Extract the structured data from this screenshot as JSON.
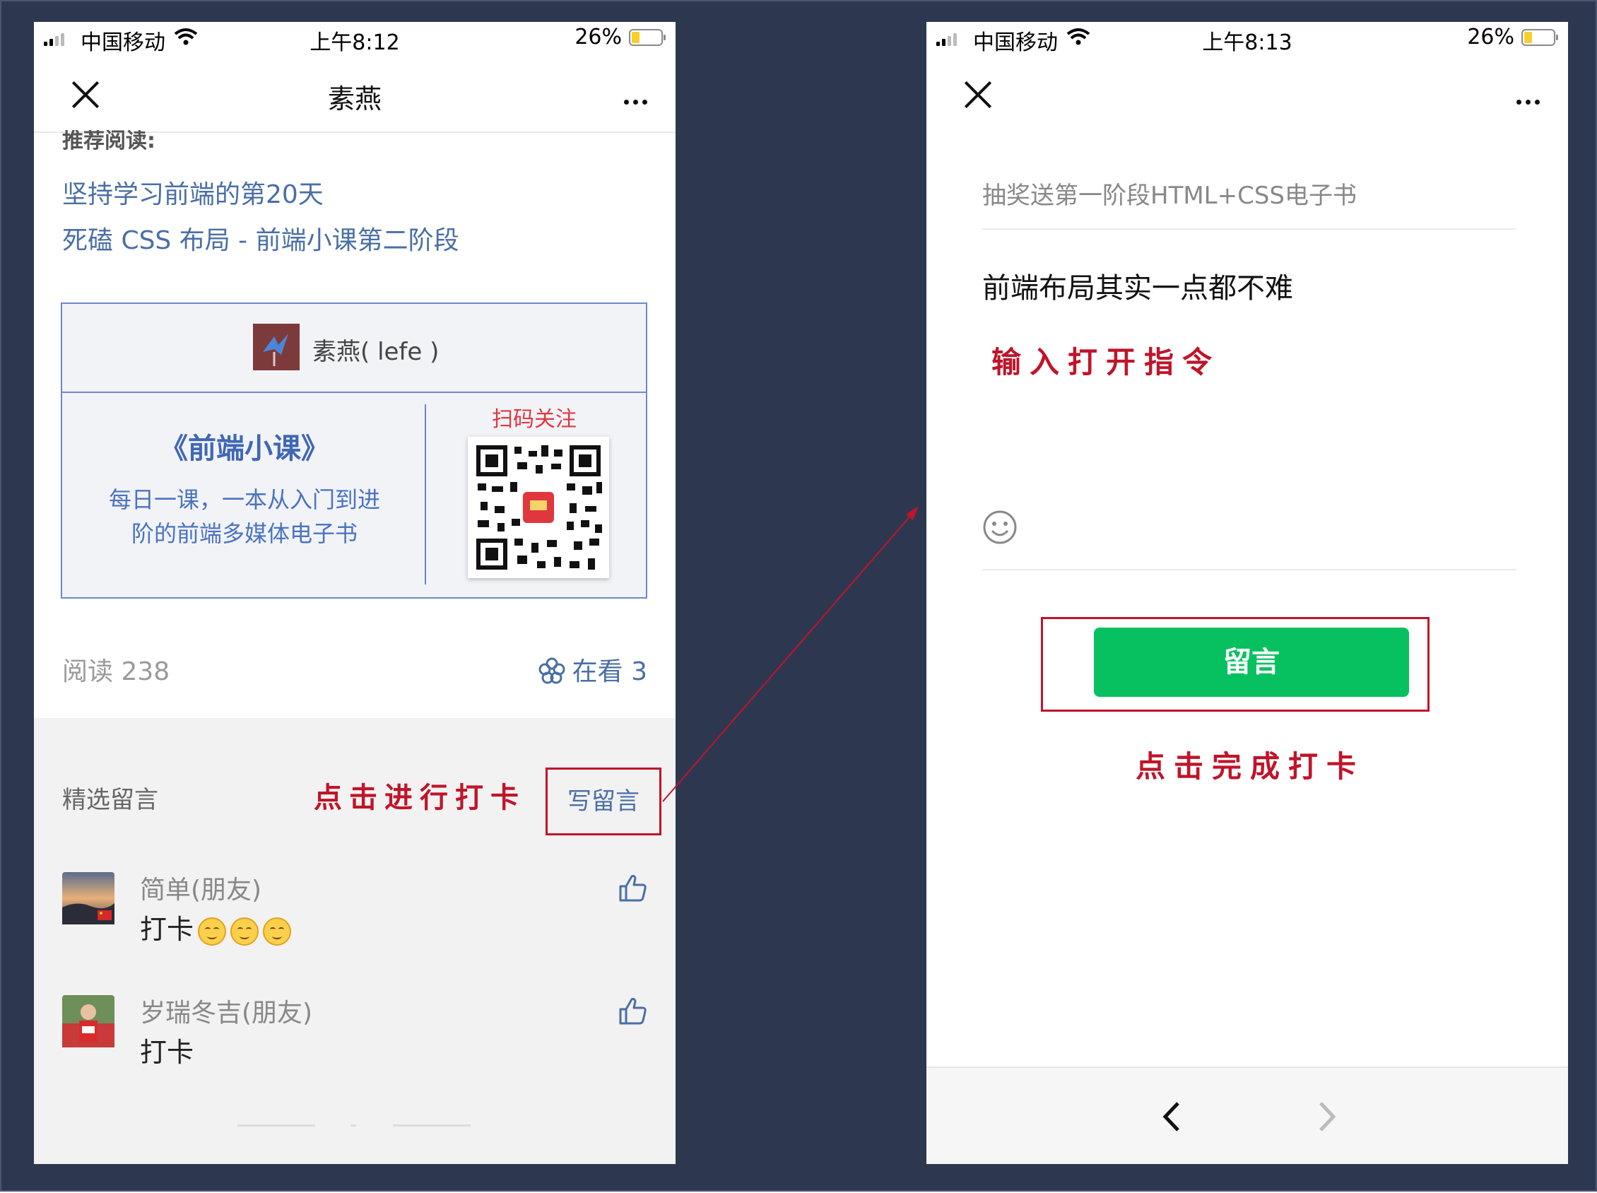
{
  "left": {
    "status": {
      "carrier": "中国移动",
      "time": "上午8:12",
      "battery": "26%"
    },
    "nav": {
      "title": "素燕"
    },
    "recommend": {
      "heading": "推荐阅读:",
      "links": [
        "坚持学习前端的第20天",
        "死磕 CSS 布局 - 前端小课第二阶段"
      ]
    },
    "card": {
      "author": "素燕( lefe )",
      "title": "《前端小课》",
      "desc1": "每日一课，一本从入门到进",
      "desc2": "阶的前端多媒体电子书",
      "scan": "扫码关注"
    },
    "stats": {
      "read": "阅读 238",
      "viewing": "在看 3"
    },
    "comments": {
      "heading": "精选留言",
      "hint": "点击进行打卡",
      "write": "写留言",
      "items": [
        {
          "name": "简单(朋友)",
          "text": "打卡"
        },
        {
          "name": "岁瑞冬吉(朋友)",
          "text": "打卡"
        }
      ]
    }
  },
  "right": {
    "status": {
      "carrier": "中国移动",
      "time": "上午8:13",
      "battery": "26%"
    },
    "article_title": "抽奖送第一阶段HTML+CSS电子书",
    "input_text": "前端布局其实一点都不难",
    "hint_input": "输入打开指令",
    "submit": "留言",
    "hint_done": "点击完成打卡"
  },
  "colors": {
    "wechat_green": "#07c160",
    "annotation_red": "#c0142a",
    "link_blue": "#4a6fa5",
    "background": "#2d3850"
  }
}
